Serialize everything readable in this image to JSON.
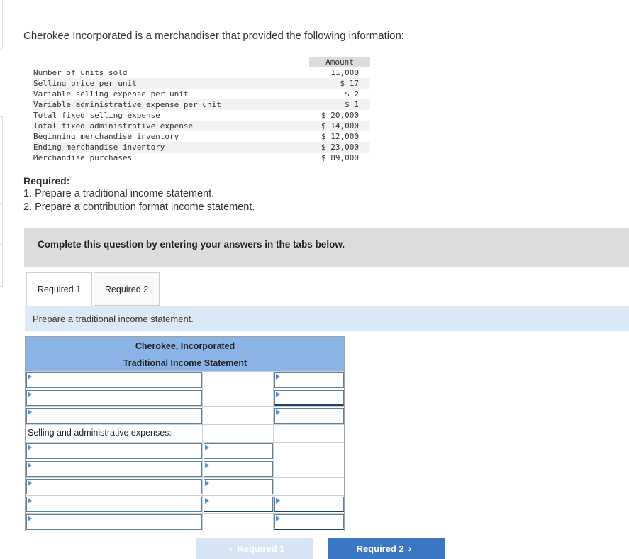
{
  "question": {
    "intro": "Cherokee Incorporated is a merchandiser that provided the following information:",
    "table_header": "Amount",
    "rows": [
      {
        "label": "Number of units sold",
        "value": "11,000"
      },
      {
        "label": "Selling price per unit",
        "value": "$ 17"
      },
      {
        "label": "Variable selling expense per unit",
        "value": "$ 2"
      },
      {
        "label": "Variable administrative expense per unit",
        "value": "$ 1"
      },
      {
        "label": "Total fixed selling expense",
        "value": "$ 20,000"
      },
      {
        "label": "Total fixed administrative expense",
        "value": "$ 14,000"
      },
      {
        "label": "Beginning merchandise inventory",
        "value": "$ 12,000"
      },
      {
        "label": "Ending merchandise inventory",
        "value": "$ 23,000"
      },
      {
        "label": "Merchandise purchases",
        "value": "$ 89,000"
      }
    ],
    "required_title": "Required:",
    "required_items": [
      "1. Prepare a traditional income statement.",
      "2. Prepare a contribution format income statement."
    ]
  },
  "banner": "Complete this question by entering your answers in the tabs below.",
  "tabs": [
    {
      "label": "Required 1",
      "active": true
    },
    {
      "label": "Required 2",
      "active": false
    }
  ],
  "instruction": "Prepare a traditional income statement.",
  "statement": {
    "company": "Cherokee, Incorporated",
    "title": "Traditional Income Statement",
    "sga_label": "Selling and administrative expenses:"
  },
  "nav": {
    "prev_label": "Required 1",
    "next_label": "Required 2",
    "prev_icon": "chevron-left-icon",
    "next_icon": "chevron-right-icon"
  },
  "colors": {
    "header_blue": "#8ab4e5",
    "instruction_bg": "#dbe9f7",
    "next_button": "#3a76c4",
    "prev_button_disabled": "#d6e4f3"
  }
}
